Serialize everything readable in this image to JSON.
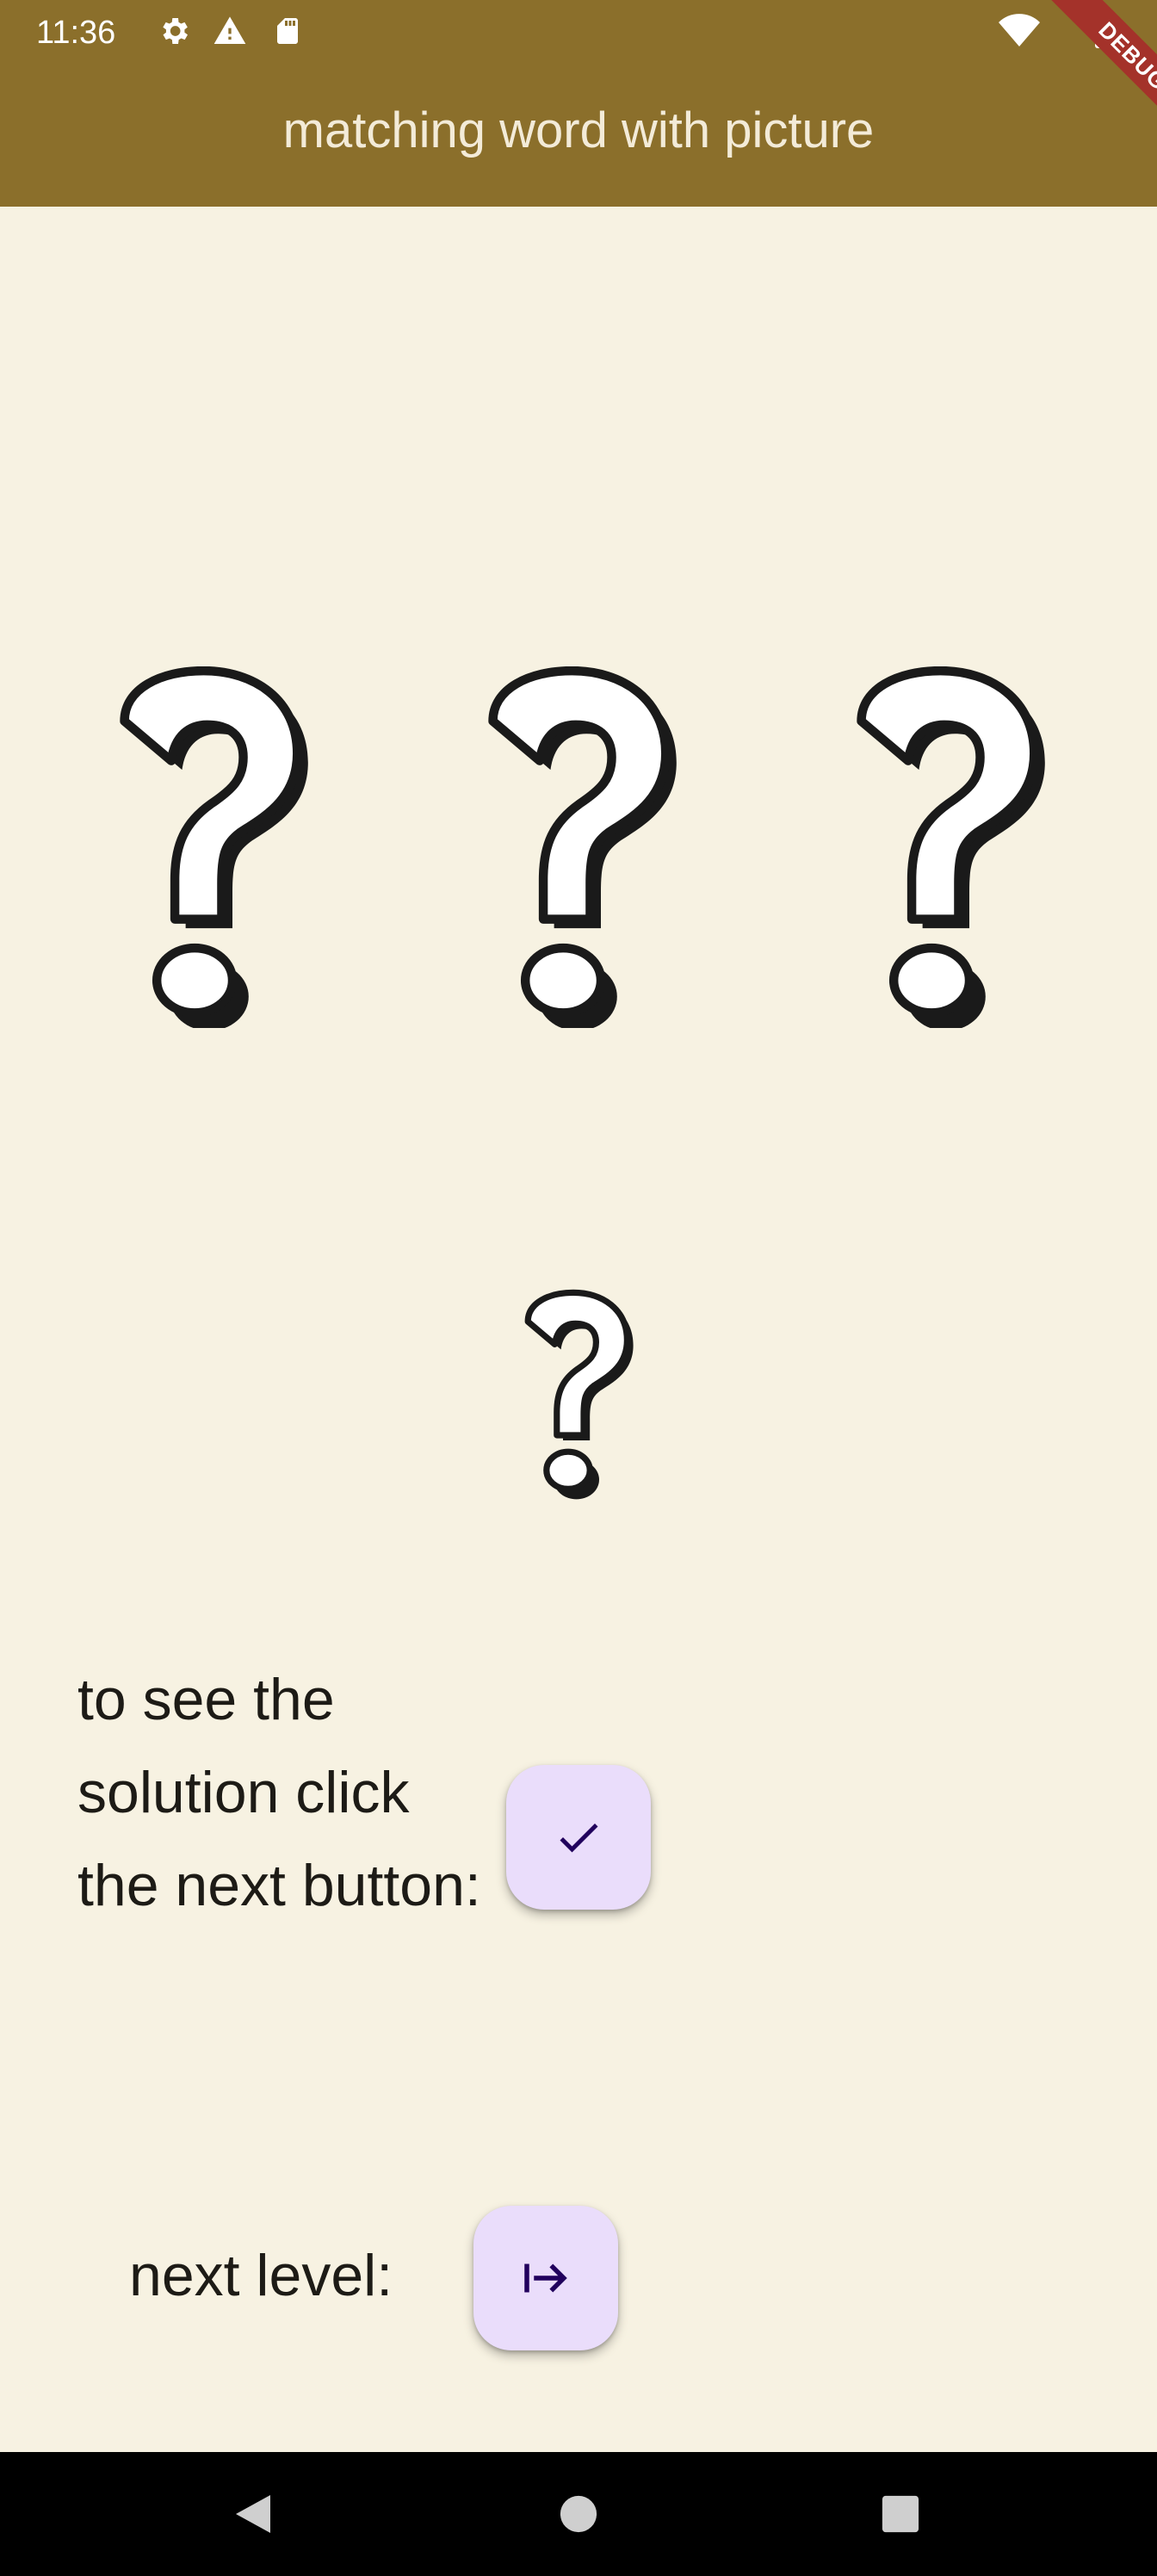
{
  "status_bar": {
    "time": "11:36",
    "icons": [
      "gear-icon",
      "warning-icon",
      "sd-card-icon",
      "wifi-icon",
      "battery-icon"
    ]
  },
  "app_bar": {
    "title": "matching word with picture",
    "background_color": "#8B6F2B"
  },
  "debug_banner": {
    "label": "DEBUG"
  },
  "choices": {
    "images": [
      "question-mark-icon",
      "question-mark-icon",
      "question-mark-icon"
    ]
  },
  "target": {
    "image": "question-mark-icon"
  },
  "solution": {
    "instruction": "to see the solution click the next button:",
    "button_icon": "check-icon"
  },
  "next_level": {
    "label": "next level:",
    "button_icon": "arrow-right-from-bar-icon"
  },
  "colors": {
    "background": "#F7F2E2",
    "fab": "#EADDFB",
    "fab_icon": "#21005D"
  },
  "nav_bar": {
    "buttons": [
      "back-icon",
      "home-icon",
      "recents-icon"
    ]
  }
}
